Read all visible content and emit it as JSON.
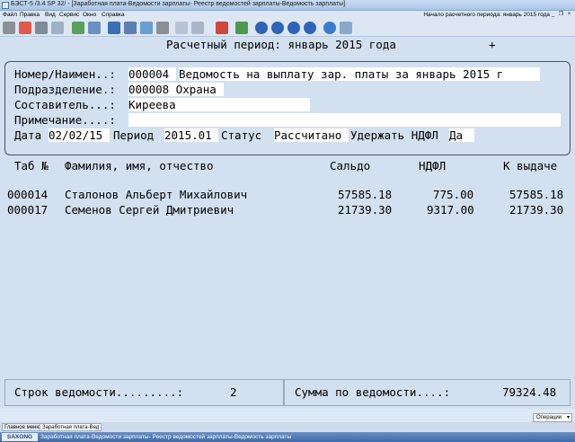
{
  "window": {
    "title": "БЭСТ-5 /3.4 SP 32/ - [Заработная плата-Ведомости зарплаты- Реестр ведомостей зарплаты-Ведомость зарплаты]"
  },
  "menu": {
    "items": [
      "Файл",
      "Правка",
      "Вид",
      "Сервис",
      "Окно",
      "Справка"
    ],
    "period_text": "Начало расчетного периода: январь 2015 года",
    "controls": [
      "_",
      "❐",
      "×"
    ]
  },
  "toolbar": {
    "icons": [
      "exit-icon",
      "calculator-icon",
      "printer-icon",
      "print-preview-icon",
      "edit-icon",
      "filter-list-icon",
      "save-icon",
      "table-icon",
      "refresh-icon",
      "tools-icon",
      "filter-icon",
      "filter-menu-icon",
      "delete-icon",
      "import-icon",
      "first-icon",
      "prev-icon",
      "next-icon",
      "last-icon",
      "help-icon",
      "document-check-icon"
    ]
  },
  "document": {
    "period_title": "Расчетный период: январь 2015 года",
    "plus": "+",
    "header": {
      "number_label": "Номер/Наимен..:",
      "number_value": "000004",
      "name_value": "Ведомость на выплату зар. платы за январь 2015 г",
      "dept_label": "Подразделение.:",
      "dept_value": "000008 Охрана",
      "author_label": "Составитель...:",
      "author_value": "Киреева",
      "note_label": "Примечание....:",
      "note_value": "",
      "date_label": "Дата",
      "date_value": "02/02/15",
      "period_label": "Период",
      "period_value": "2015.01",
      "status_label": "Статус",
      "status_value": "Рассчитано",
      "ndfl_label": "Удержать НДФЛ",
      "ndfl_value": "Да"
    },
    "columns": {
      "tab": "Таб №",
      "name": "Фамилия, имя, отчество",
      "saldo": "Сальдо",
      "ndfl": "НДФЛ",
      "payout": "К выдаче"
    },
    "rows": [
      {
        "tab": "000014",
        "name": "Сталонов Альберт Михайлович",
        "saldo": "57585.18",
        "ndfl": "775.00",
        "payout": "57585.18"
      },
      {
        "tab": "000017",
        "name": "Семенов Сергей Дмитриевич",
        "saldo": "21739.30",
        "ndfl": "9317.00",
        "payout": "21739.30"
      }
    ],
    "footer": {
      "rows_label": "Строк ведомости.........:",
      "rows_value": "2",
      "sum_label": "Сумма по ведомости....:",
      "sum_value": "79324.48"
    }
  },
  "bottom": {
    "operations": "Операции",
    "tabs": [
      "Главное меню",
      "Заработная плата-Вед"
    ],
    "taskbar_logo": "SAXONG",
    "taskbar_text": "Заработная плата-Ведомости зарплаты- Реестр ведомостей зарплаты-Ведомость зарплаты"
  },
  "colors": {
    "doc_bg": "#d3e0f0",
    "field_bg": "#ffffff",
    "taskbar": "#3f6aa8"
  }
}
